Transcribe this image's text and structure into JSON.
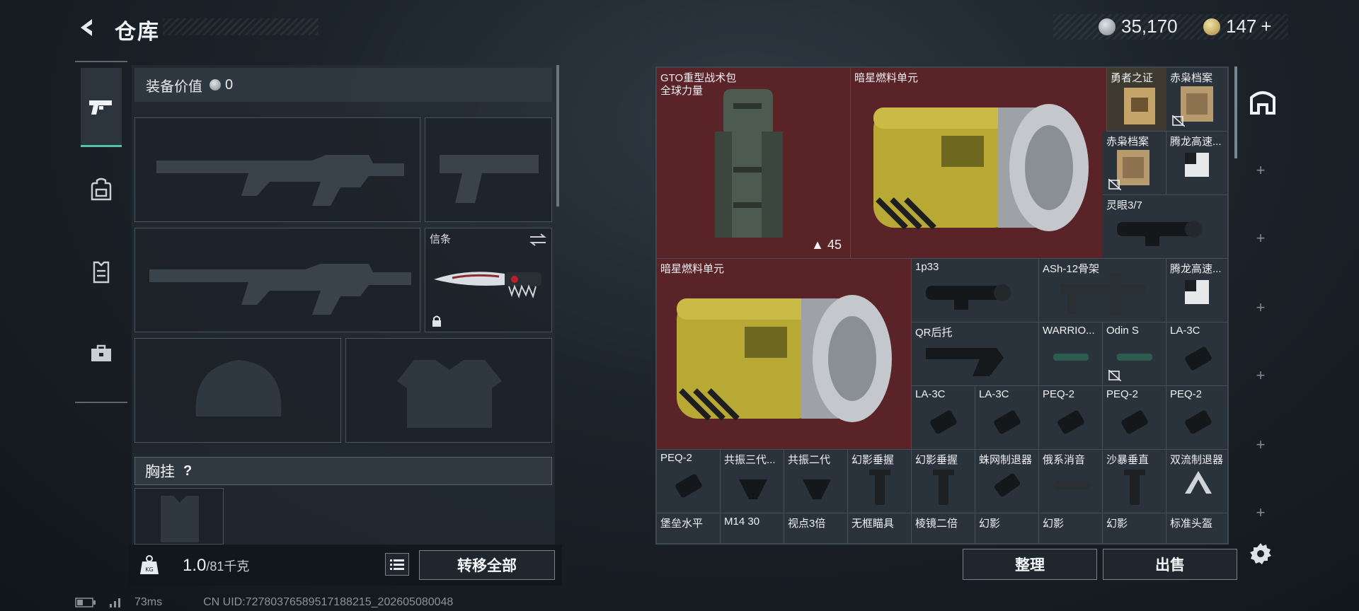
{
  "header": {
    "title": "仓库",
    "currency_silver": "35,170",
    "currency_gold": "147",
    "gold_plus": "+"
  },
  "colors": {
    "accent": "#52c4a8",
    "storage_red": "#5a2328",
    "cell": "#2a333c"
  },
  "tabs": [
    {
      "icon": "pistol-icon",
      "active": true
    },
    {
      "icon": "backpack-icon",
      "active": false
    },
    {
      "icon": "vest-icon",
      "active": false
    },
    {
      "icon": "toolbox-icon",
      "active": false
    }
  ],
  "equipment": {
    "value_label": "装备价值",
    "value": "0",
    "knife_label": "信条",
    "chest_label": "胸挂",
    "chest_help": "?"
  },
  "weight": {
    "current": "1.0",
    "max": "/81千克"
  },
  "actions": {
    "transfer_all": "转移全部",
    "sort": "整理",
    "sell": "出售"
  },
  "status": {
    "ping": "73ms",
    "uid": "CN UID:72780376589517188215_202605080048"
  },
  "storage": {
    "big": [
      {
        "name": "GTO重型战术包",
        "sub": "全球力量",
        "count": "45"
      },
      {
        "name": "暗星燃料单元"
      },
      {
        "name": "暗星燃料单元"
      }
    ],
    "small": [
      "勇者之证",
      "赤枭档案",
      "赤枭档案",
      "腾龙高速...",
      "灵眼3/7",
      "1p33",
      "ASh-12骨架",
      "腾龙高速...",
      "QR后托",
      "WARRIO...",
      "Odin S",
      "LA-3C",
      "LA-3C",
      "LA-3C",
      "PEQ-2",
      "PEQ-2",
      "PEQ-2",
      "PEQ-2",
      "共振三代...",
      "共振二代",
      "幻影垂握",
      "幻影垂握",
      "蛛网制退器",
      "俄系消音",
      "沙暴垂直",
      "双流制退器",
      "堡垒水平",
      "M14 30",
      "视点3倍",
      "无框瞄具",
      "棱镜二倍",
      "幻影",
      "幻影",
      "幻影",
      "标准头盔"
    ]
  }
}
